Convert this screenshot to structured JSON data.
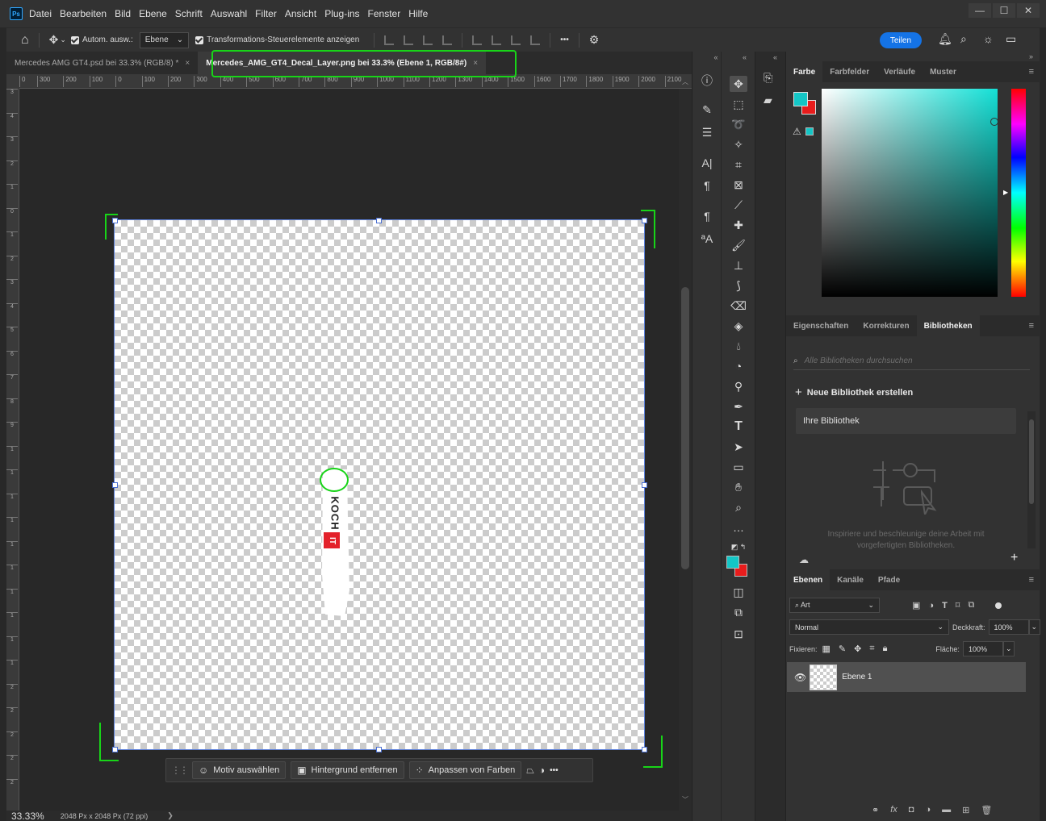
{
  "app": {
    "logo": "Ps"
  },
  "menu": [
    "Datei",
    "Bearbeiten",
    "Bild",
    "Ebene",
    "Schrift",
    "Auswahl",
    "Filter",
    "Ansicht",
    "Plug-ins",
    "Fenster",
    "Hilfe"
  ],
  "window_controls": [
    "—",
    "☐",
    "✕"
  ],
  "options": {
    "auto_select": "Autom. ausw.:",
    "auto_select_target": "Ebene",
    "transform_controls": "Transformations-Steuerelemente anzeigen",
    "more": "•••",
    "share": "Teilen"
  },
  "tabs": [
    {
      "label": "Mercedes AMG GT4.psd bei 33.3% (RGB/8) *",
      "close": "×"
    },
    {
      "label": "Mercedes_AMG_GT4_Decal_Layer.png bei 33.3% (Ebene 1, RGB/8#)",
      "close": "×"
    }
  ],
  "ruler": {
    "h": [
      "0",
      "300",
      "200",
      "100",
      "0",
      "100",
      "200",
      "300",
      "400",
      "500",
      "600",
      "700",
      "800",
      "900",
      "1000",
      "1100",
      "1200",
      "1300",
      "1400",
      "1500",
      "1600",
      "1700",
      "1800",
      "1900",
      "2000",
      "2100"
    ],
    "v": [
      "3",
      "4",
      "3",
      "2",
      "1",
      "0",
      "1",
      "2",
      "3",
      "4",
      "5",
      "6",
      "7",
      "8",
      "9",
      "1",
      "1",
      "1",
      "1",
      "1",
      "1",
      "1",
      "1",
      "1",
      "1",
      "2",
      "2",
      "2",
      "2",
      "2"
    ]
  },
  "decal": {
    "text": "KOCH",
    "badge": "IT",
    "brand_color": "#e3212a"
  },
  "context_bar": {
    "select_subject": "Motiv auswählen",
    "remove_background": "Hintergrund entfernen",
    "adjust_colors": "Anpassen von Farben",
    "more": "•••"
  },
  "status": {
    "zoom": "33.33%",
    "doc_info": "2048 Px x 2048 Px (72 ppi)",
    "arrow": "❯"
  },
  "color_panel": {
    "tabs": [
      "Farbe",
      "Farbfelder",
      "Verläufe",
      "Muster"
    ],
    "foreground": "#14c6c6",
    "background": "#e81c1c"
  },
  "library_panel": {
    "tabs": [
      "Eigenschaften",
      "Korrekturen",
      "Bibliotheken"
    ],
    "search_placeholder": "Alle Bibliotheken durchsuchen",
    "new_library": "Neue Bibliothek erstellen",
    "your_library": "Ihre Bibliothek",
    "info": "Inspiriere und beschleunige deine Arbeit mit vorgefertigten Bibliotheken.",
    "add": "+"
  },
  "layers_panel": {
    "tabs": [
      "Ebenen",
      "Kanäle",
      "Pfade"
    ],
    "filter": "Art",
    "blend_mode": "Normal",
    "opacity_label": "Deckkraft:",
    "opacity": "100%",
    "lock_label": "Fixieren:",
    "fill_label": "Fläche:",
    "fill": "100%",
    "layer_name": "Ebene 1",
    "fx": "fx"
  },
  "colors": {
    "accent": "#1473e6",
    "annotation": "#18d418"
  }
}
